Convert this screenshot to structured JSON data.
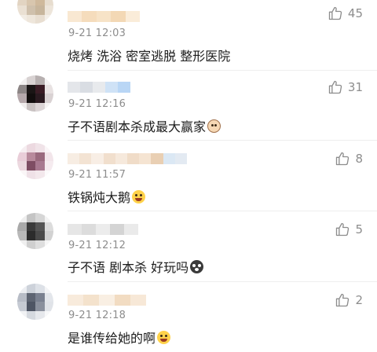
{
  "comments": [
    {
      "time": "9-21 12:03",
      "text": "烧烤 洗浴 密室逃脱 整形医院",
      "likes": "45",
      "emoji": ""
    },
    {
      "time": "9-21 12:16",
      "text": "子不语剧本杀成最大赢家",
      "likes": "31",
      "emoji": "cat-face-emoji"
    },
    {
      "time": "9-21 11:57",
      "text": "铁锅炖大鹅",
      "likes": "8",
      "emoji": "laughing-tears-emoji"
    },
    {
      "time": "9-21 12:12",
      "text": "子不语 剧本杀 好玩吗",
      "likes": "5",
      "emoji": "shocked-face-emoji"
    },
    {
      "time": "9-21 12:18",
      "text": "是谁传给她的啊",
      "likes": "2",
      "emoji": "grinning-sweat-emoji"
    }
  ],
  "colors": {
    "time": "#8d8d8d",
    "text": "#1c1c1c",
    "like": "#8d8d8d"
  },
  "icons": {
    "like": "thumbs-up-outline-icon"
  }
}
